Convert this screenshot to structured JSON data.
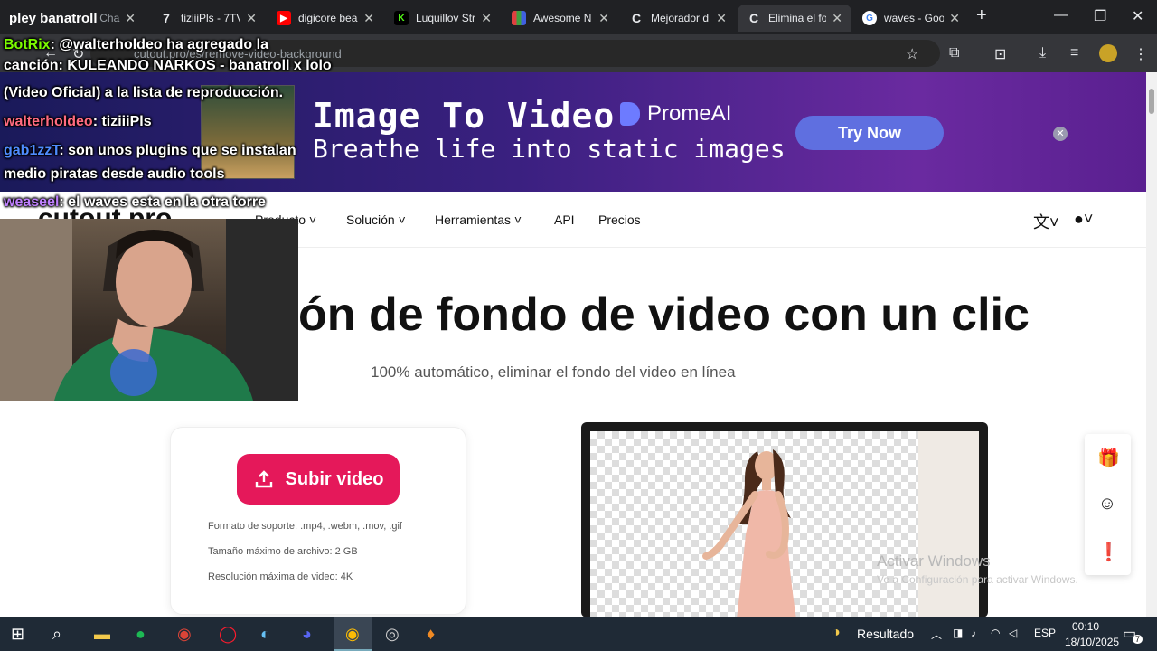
{
  "browser": {
    "tabs": [
      {
        "label": "pley banatroll",
        "partial": "Cha",
        "icon": "twitch-icon",
        "color": "#9146ff"
      },
      {
        "label": "tiziiiPls - 7TV",
        "icon": "7tv-icon",
        "color": "#29b6f6"
      },
      {
        "label": "digicore bea",
        "icon": "youtube-icon",
        "color": "#ff0000"
      },
      {
        "label": "Luquillov Str",
        "icon": "kick-icon",
        "color": "#53fc18"
      },
      {
        "label": "Awesome N",
        "icon": "grid-icon",
        "color": "#e8a33d"
      },
      {
        "label": "Mejorador d",
        "icon": "cutout-icon",
        "color": "#ffffff"
      },
      {
        "label": "Elimina el fo",
        "icon": "cutout-icon",
        "color": "#ffffff"
      },
      {
        "label": "waves - Goo",
        "icon": "google-icon",
        "color": "#4285f4"
      }
    ],
    "new_tab": "+",
    "url": "cutout.pro/es/remove-video-background"
  },
  "ad": {
    "headline": "Image To Video",
    "tagline": "Breathe life into static images",
    "brand": "PromeAI",
    "cta": "Try Now",
    "close": "✕"
  },
  "site": {
    "logo": "cutout.pro",
    "nav": [
      "Producto",
      "Solución",
      "Herramientas",
      "API",
      "Precios"
    ],
    "hero_title": "ón de fondo de video con un clic",
    "hero_sub": "100% automático, eliminar el fondo del video en línea",
    "upload_label": "Subir video",
    "specs": [
      "Formato de soporte: .mp4, .webm, .mov, .gif",
      "Tamaño máximo de archivo: 2 GB",
      "Resolución máxima de video: 4K"
    ]
  },
  "chat": [
    {
      "user": "BotRix",
      "user_color": "#7cfc00",
      "text": ": @walterholdeo ha agregado la"
    },
    {
      "user": "",
      "user_color": "#ffffff",
      "text": "canción: KULEANDO NARKOS - banatroll x lolo"
    },
    {
      "user": "",
      "user_color": "#ffffff",
      "text": "(Video Oficial) a la lista de reproducción."
    },
    {
      "user": "walterholdeo",
      "user_color": "#ff6b81",
      "text": ": tiziiiPls"
    },
    {
      "user": "gab1zzT",
      "user_color": "#4f8cff",
      "text": ": son unos plugins que se instalan"
    },
    {
      "user": "",
      "user_color": "#ffffff",
      "text": "medio piratas desde audio tools"
    },
    {
      "user": "weaseel",
      "user_color": "#c080ff",
      "text": ": el waves esta en la otra torre"
    }
  ],
  "windows": {
    "watermark": "Activar Windows",
    "watermark_sub": "Ve a Configuración para activar Windows.",
    "weather": "Resultado",
    "lang": "ESP",
    "time": "00:10",
    "date": "18/10/2025",
    "notifications": "7"
  }
}
